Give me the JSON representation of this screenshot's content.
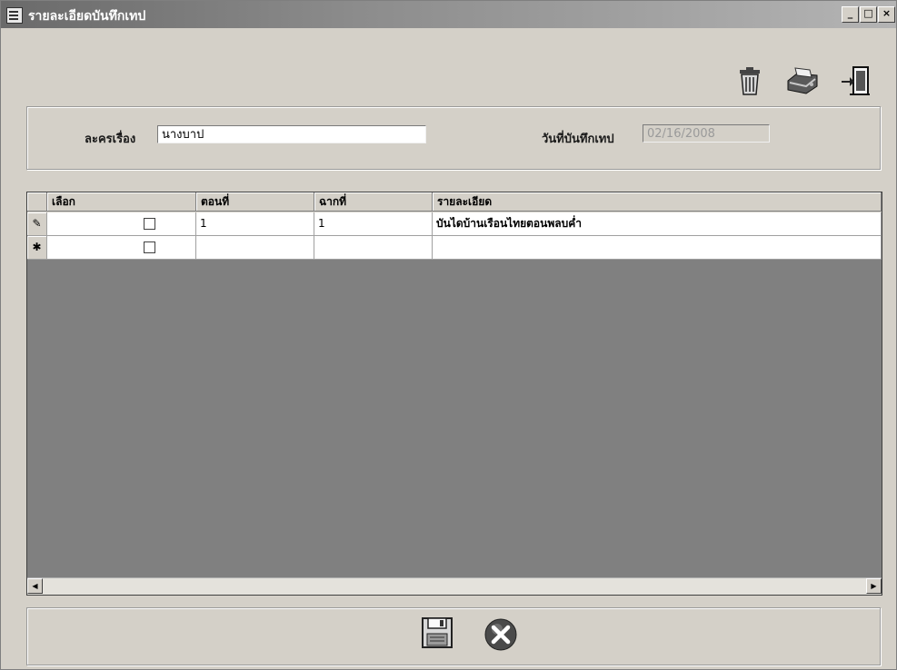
{
  "window": {
    "title": "รายละเอียดบันทึกเทป",
    "controls": {
      "minimize": "_",
      "maximize": "□",
      "close": "×"
    }
  },
  "toolbar": {
    "icons": [
      "trash-icon",
      "printer-icon",
      "exit-door-icon"
    ]
  },
  "form": {
    "drama_label": "ละครเรื่อง",
    "drama_value": "นางบาป",
    "date_label": "วันที่บันทึกเทป",
    "date_value": "02/16/2008"
  },
  "grid": {
    "columns": [
      "เลือก",
      "ตอนที่",
      "ฉากที่",
      "รายละเอียด"
    ],
    "rows": [
      {
        "marker": "✎",
        "selected": false,
        "episode": "1",
        "scene": "1",
        "detail": "บันไดบ้านเรือนไทยตอนพลบค่ำ"
      },
      {
        "marker": "✱",
        "selected": false,
        "episode": "",
        "scene": "",
        "detail": ""
      }
    ]
  },
  "bottom_buttons": {
    "icons": [
      "save-floppy-icon",
      "cancel-x-icon"
    ]
  },
  "colors": {
    "titlebar": "#6a6a6a",
    "window_bg": "#d4d0c8",
    "grid_bg": "#808080",
    "cancel_button": "#4a4a4a"
  }
}
